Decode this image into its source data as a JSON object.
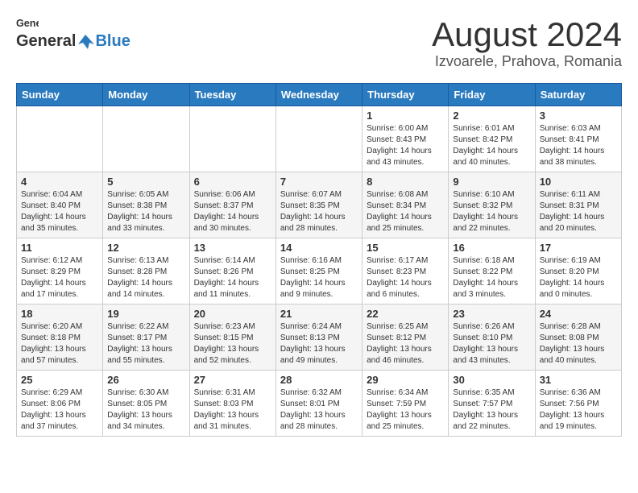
{
  "logo": {
    "general": "General",
    "blue": "Blue"
  },
  "title": {
    "month_year": "August 2024",
    "location": "Izvoarele, Prahova, Romania"
  },
  "days_of_week": [
    "Sunday",
    "Monday",
    "Tuesday",
    "Wednesday",
    "Thursday",
    "Friday",
    "Saturday"
  ],
  "weeks": [
    [
      {
        "day": "",
        "info": ""
      },
      {
        "day": "",
        "info": ""
      },
      {
        "day": "",
        "info": ""
      },
      {
        "day": "",
        "info": ""
      },
      {
        "day": "1",
        "info": "Sunrise: 6:00 AM\nSunset: 8:43 PM\nDaylight: 14 hours\nand 43 minutes."
      },
      {
        "day": "2",
        "info": "Sunrise: 6:01 AM\nSunset: 8:42 PM\nDaylight: 14 hours\nand 40 minutes."
      },
      {
        "day": "3",
        "info": "Sunrise: 6:03 AM\nSunset: 8:41 PM\nDaylight: 14 hours\nand 38 minutes."
      }
    ],
    [
      {
        "day": "4",
        "info": "Sunrise: 6:04 AM\nSunset: 8:40 PM\nDaylight: 14 hours\nand 35 minutes."
      },
      {
        "day": "5",
        "info": "Sunrise: 6:05 AM\nSunset: 8:38 PM\nDaylight: 14 hours\nand 33 minutes."
      },
      {
        "day": "6",
        "info": "Sunrise: 6:06 AM\nSunset: 8:37 PM\nDaylight: 14 hours\nand 30 minutes."
      },
      {
        "day": "7",
        "info": "Sunrise: 6:07 AM\nSunset: 8:35 PM\nDaylight: 14 hours\nand 28 minutes."
      },
      {
        "day": "8",
        "info": "Sunrise: 6:08 AM\nSunset: 8:34 PM\nDaylight: 14 hours\nand 25 minutes."
      },
      {
        "day": "9",
        "info": "Sunrise: 6:10 AM\nSunset: 8:32 PM\nDaylight: 14 hours\nand 22 minutes."
      },
      {
        "day": "10",
        "info": "Sunrise: 6:11 AM\nSunset: 8:31 PM\nDaylight: 14 hours\nand 20 minutes."
      }
    ],
    [
      {
        "day": "11",
        "info": "Sunrise: 6:12 AM\nSunset: 8:29 PM\nDaylight: 14 hours\nand 17 minutes."
      },
      {
        "day": "12",
        "info": "Sunrise: 6:13 AM\nSunset: 8:28 PM\nDaylight: 14 hours\nand 14 minutes."
      },
      {
        "day": "13",
        "info": "Sunrise: 6:14 AM\nSunset: 8:26 PM\nDaylight: 14 hours\nand 11 minutes."
      },
      {
        "day": "14",
        "info": "Sunrise: 6:16 AM\nSunset: 8:25 PM\nDaylight: 14 hours\nand 9 minutes."
      },
      {
        "day": "15",
        "info": "Sunrise: 6:17 AM\nSunset: 8:23 PM\nDaylight: 14 hours\nand 6 minutes."
      },
      {
        "day": "16",
        "info": "Sunrise: 6:18 AM\nSunset: 8:22 PM\nDaylight: 14 hours\nand 3 minutes."
      },
      {
        "day": "17",
        "info": "Sunrise: 6:19 AM\nSunset: 8:20 PM\nDaylight: 14 hours\nand 0 minutes."
      }
    ],
    [
      {
        "day": "18",
        "info": "Sunrise: 6:20 AM\nSunset: 8:18 PM\nDaylight: 13 hours\nand 57 minutes."
      },
      {
        "day": "19",
        "info": "Sunrise: 6:22 AM\nSunset: 8:17 PM\nDaylight: 13 hours\nand 55 minutes."
      },
      {
        "day": "20",
        "info": "Sunrise: 6:23 AM\nSunset: 8:15 PM\nDaylight: 13 hours\nand 52 minutes."
      },
      {
        "day": "21",
        "info": "Sunrise: 6:24 AM\nSunset: 8:13 PM\nDaylight: 13 hours\nand 49 minutes."
      },
      {
        "day": "22",
        "info": "Sunrise: 6:25 AM\nSunset: 8:12 PM\nDaylight: 13 hours\nand 46 minutes."
      },
      {
        "day": "23",
        "info": "Sunrise: 6:26 AM\nSunset: 8:10 PM\nDaylight: 13 hours\nand 43 minutes."
      },
      {
        "day": "24",
        "info": "Sunrise: 6:28 AM\nSunset: 8:08 PM\nDaylight: 13 hours\nand 40 minutes."
      }
    ],
    [
      {
        "day": "25",
        "info": "Sunrise: 6:29 AM\nSunset: 8:06 PM\nDaylight: 13 hours\nand 37 minutes."
      },
      {
        "day": "26",
        "info": "Sunrise: 6:30 AM\nSunset: 8:05 PM\nDaylight: 13 hours\nand 34 minutes."
      },
      {
        "day": "27",
        "info": "Sunrise: 6:31 AM\nSunset: 8:03 PM\nDaylight: 13 hours\nand 31 minutes."
      },
      {
        "day": "28",
        "info": "Sunrise: 6:32 AM\nSunset: 8:01 PM\nDaylight: 13 hours\nand 28 minutes."
      },
      {
        "day": "29",
        "info": "Sunrise: 6:34 AM\nSunset: 7:59 PM\nDaylight: 13 hours\nand 25 minutes."
      },
      {
        "day": "30",
        "info": "Sunrise: 6:35 AM\nSunset: 7:57 PM\nDaylight: 13 hours\nand 22 minutes."
      },
      {
        "day": "31",
        "info": "Sunrise: 6:36 AM\nSunset: 7:56 PM\nDaylight: 13 hours\nand 19 minutes."
      }
    ]
  ]
}
